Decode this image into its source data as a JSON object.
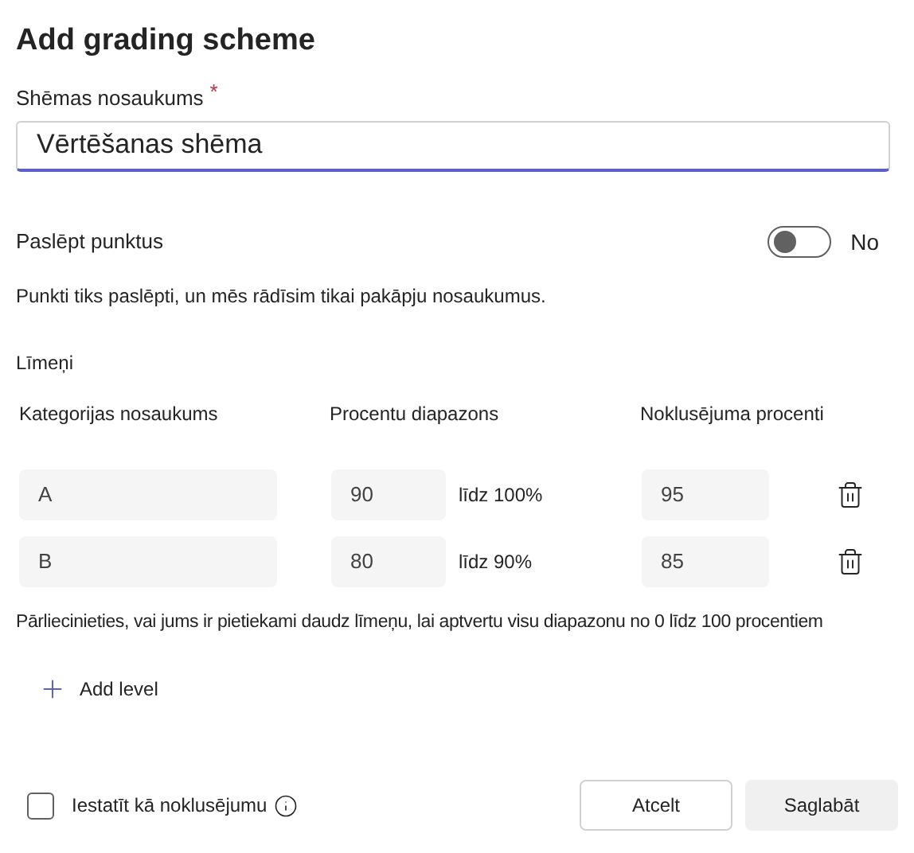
{
  "title": "Add grading scheme",
  "name_field": {
    "label": "Shēmas nosaukums",
    "required_mark": "*",
    "value": "Vērtēšanas shēma"
  },
  "hide_points": {
    "label": "Paslēpt punktus",
    "on": false,
    "state_text": "No",
    "description": "Punkti tiks paslēpti, un mēs rādīsim tikai pakāpju nosaukumus."
  },
  "levels_label": "Līmeņi",
  "columns": [
    "Kategorijas nosaukums",
    "Procentu diapazons",
    "Noklusējuma procenti"
  ],
  "levels": [
    {
      "name": "A",
      "from": "90",
      "to_text": "līdz 100%",
      "default": "95"
    },
    {
      "name": "B",
      "from": "80",
      "to_text": "līdz 90%",
      "default": "85"
    }
  ],
  "hint": "Pārliecinieties, vai jums ir pietiekami daudz līmeņu, lai aptvertu visu diapazonu no 0 līdz 100 procentiem",
  "add_level": "Add level",
  "set_default": {
    "label": "Iestatīt kā noklusējumu",
    "checked": false
  },
  "buttons": [
    "Atcelt",
    "Saglabāt"
  ]
}
